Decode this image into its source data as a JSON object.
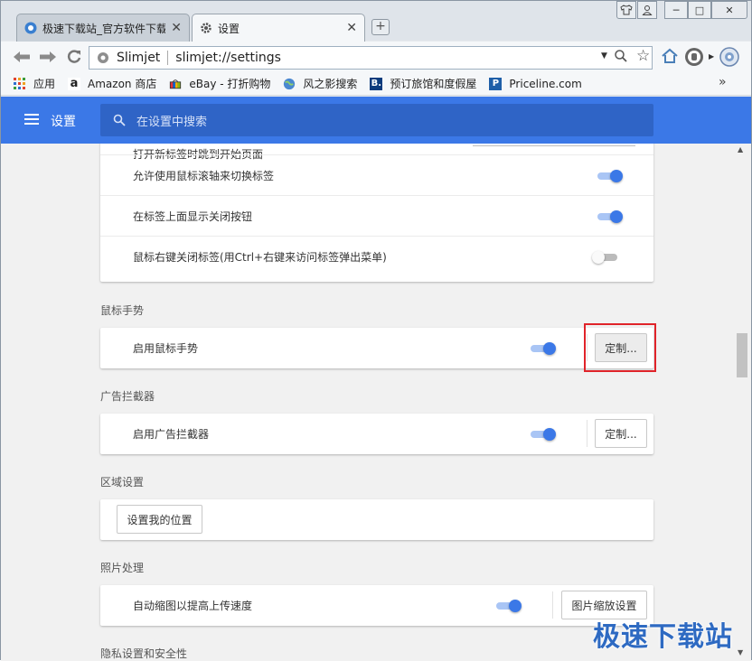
{
  "browser": {
    "tabs": [
      {
        "title": "极速下载站_官方软件下载",
        "active": false
      },
      {
        "title": "设置",
        "active": true
      }
    ],
    "new_tab_symbol": "+",
    "window_controls": [
      "─",
      "□",
      "✕"
    ],
    "omnibox": {
      "site_name": "Slimjet",
      "url": "slimjet://settings"
    },
    "bookmarks": [
      {
        "label": "应用",
        "icon": "apps-grid-icon"
      },
      {
        "label": "Amazon 商店",
        "icon": "amazon-icon"
      },
      {
        "label": "eBay - 打折购物",
        "icon": "ebay-icon"
      },
      {
        "label": "风之影搜索",
        "icon": "globe-icon"
      },
      {
        "label": "预订旅馆和度假屋",
        "icon": "booking-icon"
      },
      {
        "label": "Priceline.com",
        "icon": "priceline-icon"
      }
    ],
    "bookmarks_overflow": "»"
  },
  "settings": {
    "header_title": "设置",
    "search_placeholder": "在设置中搜索",
    "tabs_card": {
      "partial_row": "打开新标签时跳到开始页面",
      "rows": [
        {
          "label": "允许使用鼠标滚轴来切换标签",
          "enabled": true
        },
        {
          "label": "在标签上面显示关闭按钮",
          "enabled": true
        },
        {
          "label": "鼠标右键关闭标签(用Ctrl+右键来访问标签弹出菜单)",
          "enabled": false
        }
      ]
    },
    "mouse_gestures": {
      "section_title": "鼠标手势",
      "row_label": "启用鼠标手势",
      "enabled": true,
      "customize_label": "定制..."
    },
    "ad_blocker": {
      "section_title": "广告拦截器",
      "row_label": "启用广告拦截器",
      "enabled": true,
      "customize_label": "定制..."
    },
    "region": {
      "section_title": "区域设置",
      "button_label": "设置我的位置"
    },
    "photo": {
      "section_title": "照片处理",
      "row_label": "自动缩图以提高上传速度",
      "enabled": true,
      "button_label": "图片缩放设置"
    },
    "privacy_section_title": "隐私设置和安全性"
  },
  "watermark": "极速下载站",
  "colors": {
    "accent": "#3b78e7",
    "highlight_border": "#e0242a"
  }
}
